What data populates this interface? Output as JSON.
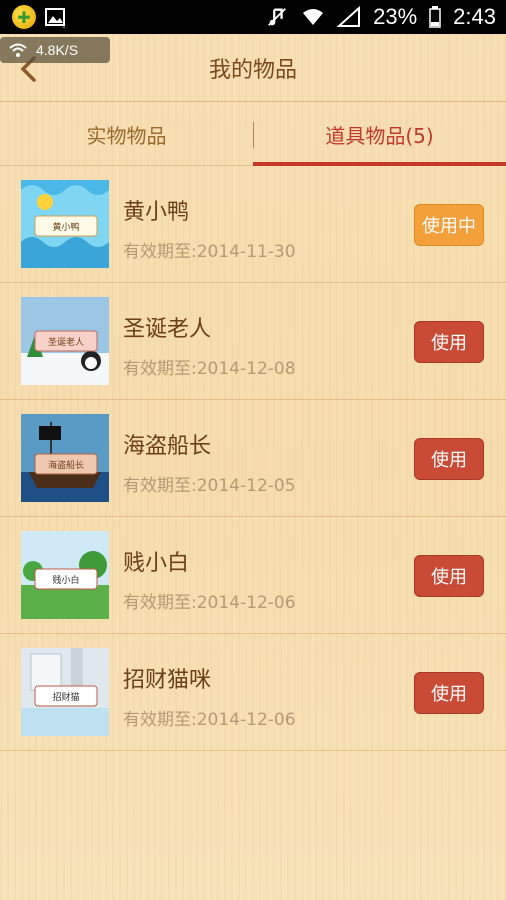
{
  "status_bar": {
    "battery": "23%",
    "time": "2:43",
    "net_speed": "4.8K/S"
  },
  "header": {
    "title": "我的物品"
  },
  "tabs": [
    {
      "label": "实物物品",
      "active": false
    },
    {
      "label": "道具物品(5)",
      "active": true
    }
  ],
  "items": [
    {
      "name": "黄小鸭",
      "date": "有效期至:2014-11-30",
      "button": "使用中",
      "thumb_label": "黄小鸭",
      "in_use": true
    },
    {
      "name": "圣诞老人",
      "date": "有效期至:2014-12-08",
      "button": "使用",
      "thumb_label": "圣诞老人",
      "in_use": false
    },
    {
      "name": "海盗船长",
      "date": "有效期至:2014-12-05",
      "button": "使用",
      "thumb_label": "海盗船长",
      "in_use": false
    },
    {
      "name": "贱小白",
      "date": "有效期至:2014-12-06",
      "button": "使用",
      "thumb_label": "贱小白",
      "in_use": false
    },
    {
      "name": "招财猫咪",
      "date": "有效期至:2014-12-06",
      "button": "使用",
      "thumb_label": "招财猫",
      "in_use": false
    }
  ],
  "colors": {
    "accent": "#c0392b",
    "in_use": "#f4a03a",
    "title_text": "#7a4a1e"
  }
}
